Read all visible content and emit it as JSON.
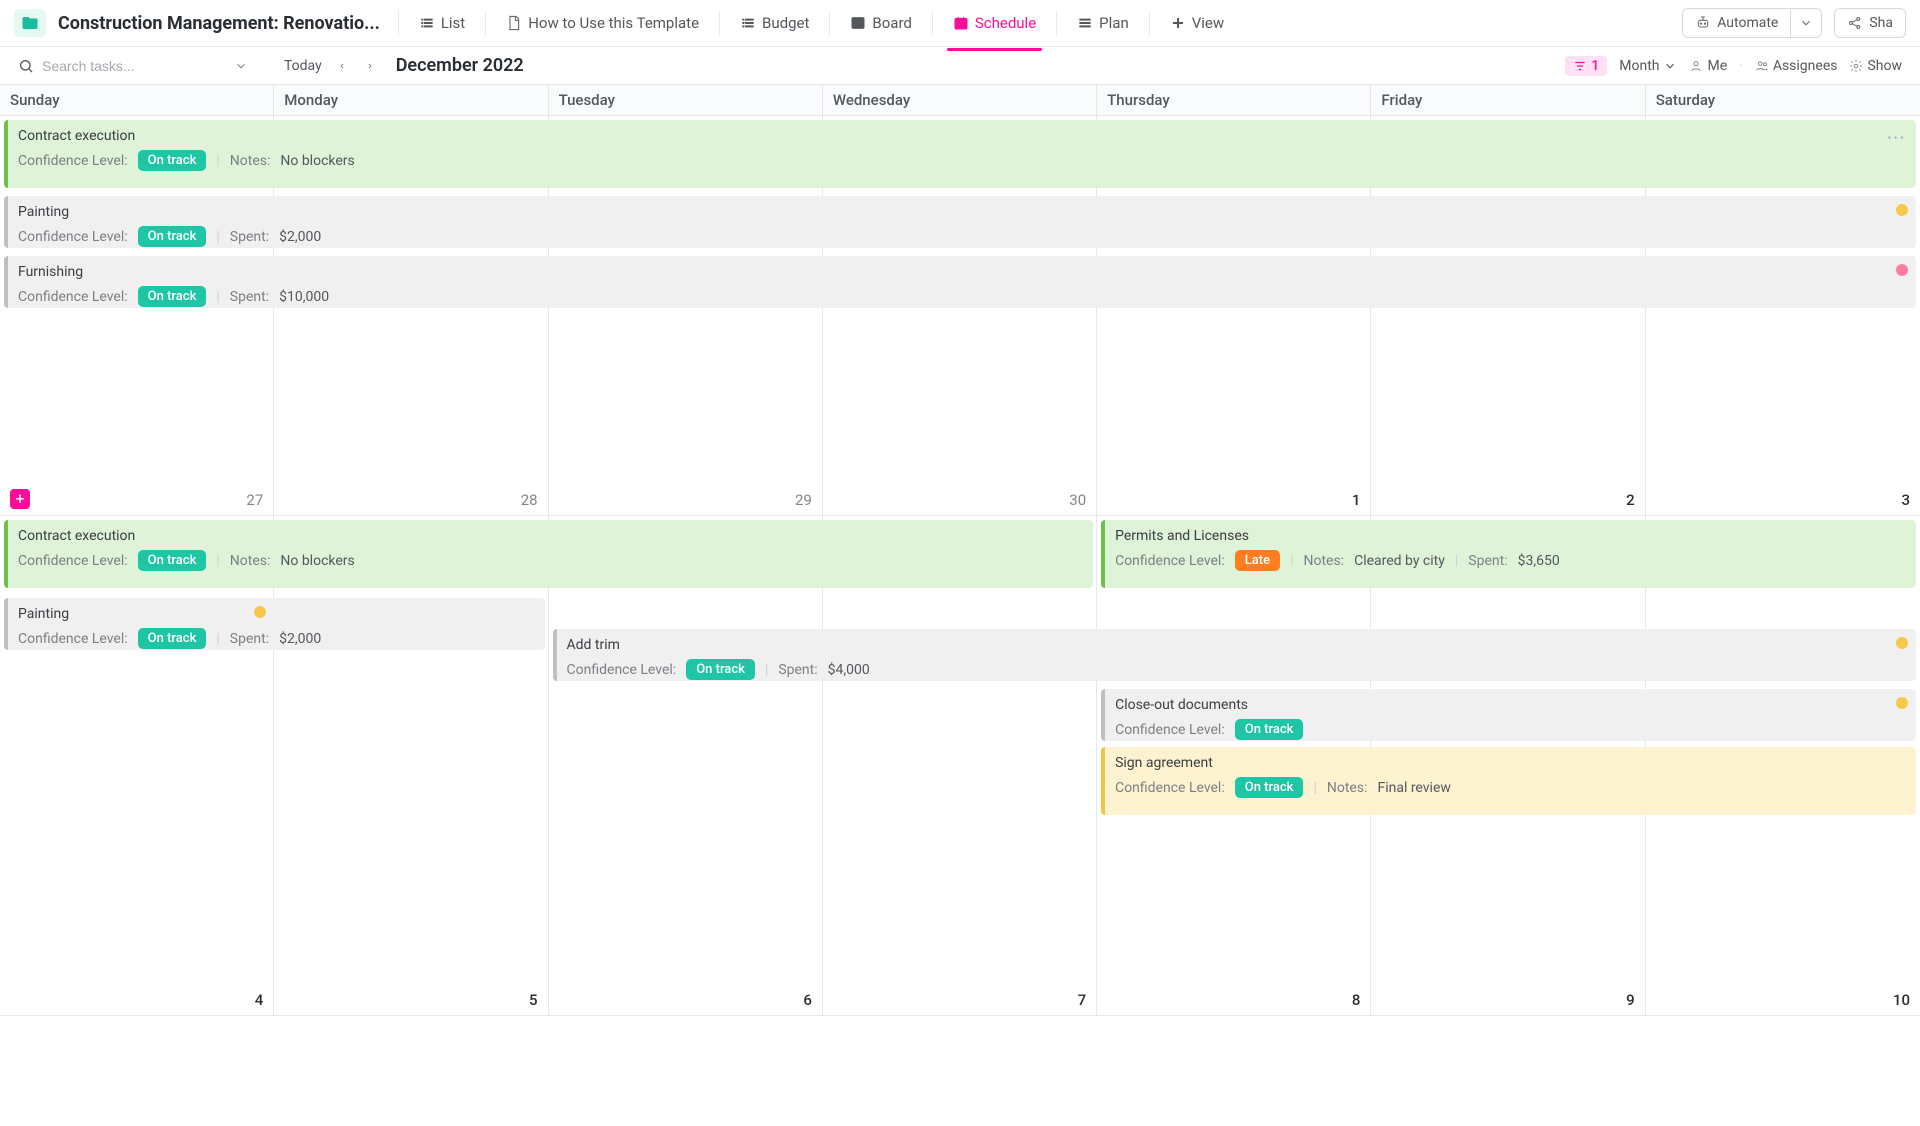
{
  "header": {
    "title": "Construction Management: Renovatio...",
    "tabs": {
      "list": "List",
      "howto": "How to Use this Template",
      "budget": "Budget",
      "board": "Board",
      "schedule": "Schedule",
      "plan": "Plan",
      "view": "View"
    },
    "automate": "Automate",
    "share": "Sha"
  },
  "toolbar": {
    "search_ph": "Search tasks...",
    "today": "Today",
    "month_label": "December 2022",
    "filter_count": "1",
    "month_btn": "Month",
    "me": "Me",
    "assignees": "Assignees",
    "show": "Show"
  },
  "days": [
    "Sunday",
    "Monday",
    "Tuesday",
    "Wednesday",
    "Thursday",
    "Friday",
    "Saturday"
  ],
  "week1": {
    "nums": [
      "27",
      "28",
      "29",
      "30",
      "1",
      "2",
      "3"
    ],
    "contract": {
      "title": "Contract execution",
      "cl": "Confidence Level:",
      "status": "On track",
      "notes_l": "Notes:",
      "notes": "No blockers"
    },
    "painting": {
      "title": "Painting",
      "cl": "Confidence Level:",
      "status": "On track",
      "spent_l": "Spent:",
      "spent": "$2,000"
    },
    "furnishing": {
      "title": "Furnishing",
      "cl": "Confidence Level:",
      "status": "On track",
      "spent_l": "Spent:",
      "spent": "$10,000"
    }
  },
  "week2": {
    "nums": [
      "4",
      "5",
      "6",
      "7",
      "8",
      "9",
      "10"
    ],
    "contract": {
      "title": "Contract execution",
      "cl": "Confidence Level:",
      "status": "On track",
      "notes_l": "Notes:",
      "notes": "No blockers"
    },
    "permits": {
      "title": "Permits and Licenses",
      "cl": "Confidence Level:",
      "status": "Late",
      "notes_l": "Notes:",
      "notes": "Cleared by city",
      "spent_l": "Spent:",
      "spent": "$3,650"
    },
    "painting": {
      "title": "Painting",
      "cl": "Confidence Level:",
      "status": "On track",
      "spent_l": "Spent:",
      "spent": "$2,000"
    },
    "addtrim": {
      "title": "Add trim",
      "cl": "Confidence Level:",
      "status": "On track",
      "spent_l": "Spent:",
      "spent": "$4,000"
    },
    "closeout": {
      "title": "Close-out documents",
      "cl": "Confidence Level:",
      "status": "On track"
    },
    "sign": {
      "title": "Sign agreement",
      "cl": "Confidence Level:",
      "status": "On track",
      "notes_l": "Notes:",
      "notes": "Final review"
    }
  }
}
